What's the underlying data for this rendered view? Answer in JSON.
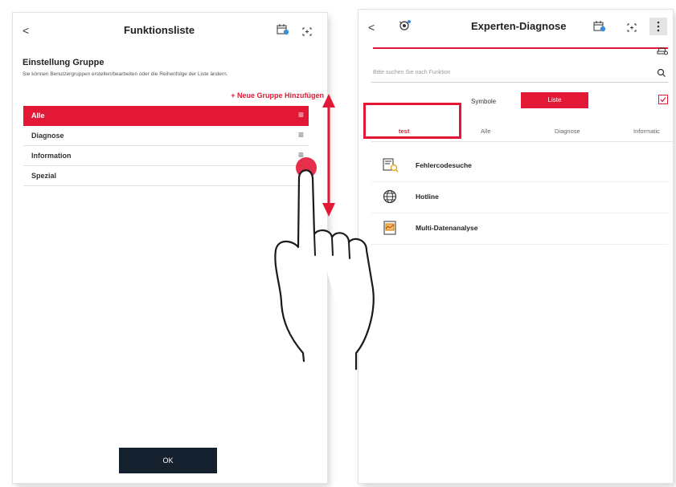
{
  "left_screen": {
    "title": "Funktionsliste",
    "back_glyph": "<",
    "section_title": "Einstellung Gruppe",
    "section_desc": "Sie können Benutzergruppen erstellen/bearbeiten oder die Reihenfolge der Liste ändern.",
    "add_group": "+ Neue Gruppe Hinzufügen",
    "groups": [
      {
        "label": "Alle",
        "active": true
      },
      {
        "label": "Diagnose",
        "active": false
      },
      {
        "label": "Information",
        "active": false
      },
      {
        "label": "Spezial",
        "active": false
      }
    ],
    "drag_glyph": "≡",
    "ok_label": "OK"
  },
  "right_screen": {
    "title": "Experten-Diagnose",
    "back_glyph": "<",
    "search_placeholder": "Bitte suchen Sie nach Funktion",
    "toggle_symbole": "Symbole",
    "toggle_liste": "Liste",
    "tabs": [
      {
        "label": "test",
        "active": true
      },
      {
        "label": "Alle",
        "active": false
      },
      {
        "label": "Diagnose",
        "active": false
      },
      {
        "label": "Informatic",
        "active": false
      }
    ],
    "functions": [
      {
        "label": "Fehlercodesuche",
        "icon": "fault-code-search-icon"
      },
      {
        "label": "Hotline",
        "icon": "globe-icon"
      },
      {
        "label": "Multi-Datenanalyse",
        "icon": "data-analysis-icon"
      }
    ]
  },
  "colors": {
    "accent": "#e31837",
    "dark_button": "#14202e"
  }
}
